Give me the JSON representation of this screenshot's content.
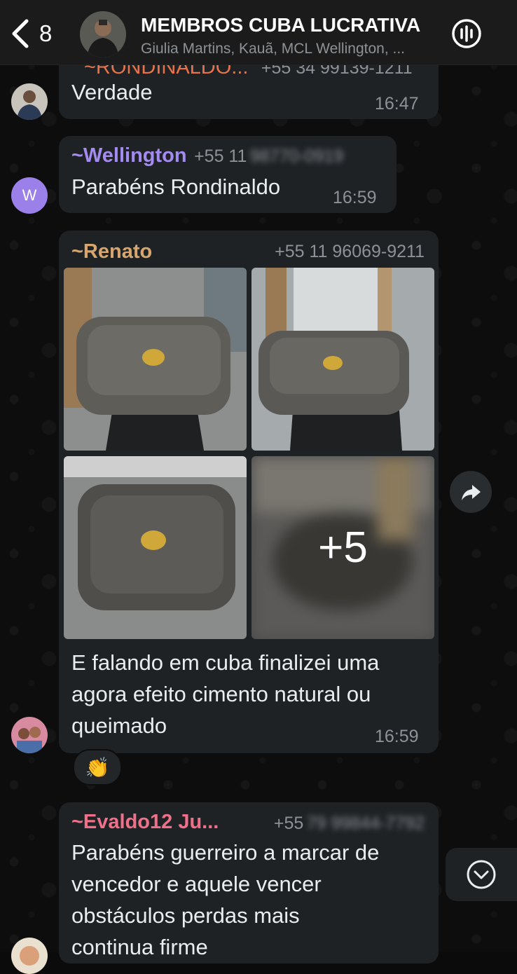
{
  "header": {
    "back_count": "8",
    "title": "MEMBROS CUBA LUCRATIVA",
    "subtitle": "Giulia Martins, Kauã, MCL Wellington, ..."
  },
  "messages": [
    {
      "partial_sender": "~RONDINALDO...",
      "partial_phone": "+55 34 99139-1211",
      "text": "Verdade",
      "time": "16:47"
    },
    {
      "sender": "~Wellington",
      "sender_color": "#a48bf0",
      "phone_prefix": "+55 11",
      "phone_blurred": "98770-0919",
      "avatar_letter": "W",
      "avatar_color": "#9a80e8",
      "text": "Parabéns Rondinaldo",
      "time": "16:59"
    },
    {
      "sender": "~Renato",
      "sender_color": "#d8a56c",
      "phone": "+55 11 96069-9211",
      "more_photos": "+5",
      "text_lines": [
        "E falando em cuba finalizei uma",
        "agora efeito cimento natural ou",
        "queimado"
      ],
      "time": "16:59",
      "reaction": "👏"
    },
    {
      "sender": "~Evaldo12 Ju...",
      "sender_color": "#f0708a",
      "phone_prefix": "+55",
      "phone_blurred": "79 99844-7792",
      "text_lines": [
        "Parabéns guerreiro a marcar de",
        "vencedor e aquele vencer",
        "obstáculos perdas mais",
        "continua firme"
      ]
    }
  ],
  "colors": {
    "header_bg": "#1b1b1b",
    "bubble_bg": "#1f2225",
    "text_primary": "#e9edef",
    "text_secondary": "#8d9296"
  },
  "icons": {
    "back": "chevron-left-icon",
    "call": "audio-call-icon",
    "forward": "share-forward-icon",
    "scroll": "chevron-down-circle-icon"
  }
}
